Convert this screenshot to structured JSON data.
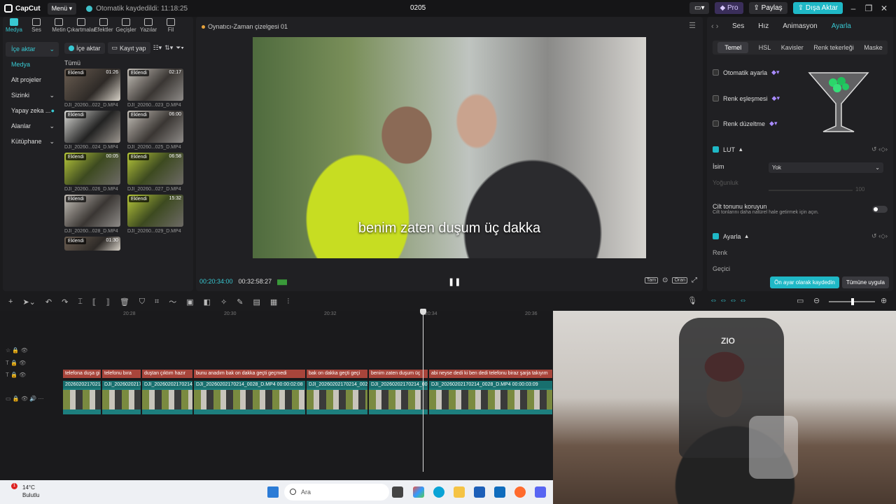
{
  "topbar": {
    "app_name": "CapCut",
    "menu_label": "Menü",
    "autosave_text": "Otomatik kaydedildi: 11:18:25",
    "project_title": "0205",
    "pro_label": "Pro",
    "share_label": "Paylaş",
    "export_label": "Dışa Aktar"
  },
  "tools": [
    "Medya",
    "Ses",
    "Metin",
    "Çıkartmalar",
    "Efektler",
    "Geçişler",
    "Yazılar",
    "Fil"
  ],
  "sidebar": {
    "items": [
      {
        "label": "İçe aktar"
      },
      {
        "label": "Medya"
      },
      {
        "label": "Alt projeler"
      },
      {
        "label": "Sizinki"
      },
      {
        "label": "Yapay zeka ..."
      },
      {
        "label": "Alanlar"
      },
      {
        "label": "Kütüphane"
      }
    ]
  },
  "media": {
    "import_label": "İçe aktar",
    "record_label": "Kayıt yap",
    "all_label": "Tümü",
    "clips": [
      {
        "tag": "Eklendi",
        "dur": "01:26",
        "name": "DJI_20260...022_D.MP4"
      },
      {
        "tag": "Eklendi",
        "dur": "02:17",
        "name": "DJI_20260...023_D.MP4"
      },
      {
        "tag": "Eklendi",
        "dur": "",
        "name": "DJI_20260...024_D.MP4"
      },
      {
        "tag": "Eklendi",
        "dur": "06:00",
        "name": "DJI_20260...025_D.MP4"
      },
      {
        "tag": "Eklendi",
        "dur": "00:05",
        "name": "DJI_20260...026_D.MP4"
      },
      {
        "tag": "Eklendi",
        "dur": "06:58",
        "name": "DJI_20260...027_D.MP4"
      },
      {
        "tag": "Eklendi",
        "dur": "",
        "name": "DJI_20260...028_D.MP4"
      },
      {
        "tag": "Eklendi",
        "dur": "15:32",
        "name": "DJI_20260...029_D.MP4"
      },
      {
        "tag": "Eklendi",
        "dur": "01:30",
        "name": ""
      }
    ]
  },
  "player": {
    "title": "Oynatıcı-Zaman çizelgesi 01",
    "subtitle": "benim zaten duşum üç dakka",
    "current_time": "00:20:34:00",
    "total_time": "00:32:58:27",
    "full_label": "Tam",
    "ratio_label": "Oran"
  },
  "rpanel": {
    "tabs": [
      "Ses",
      "Hız",
      "Animasyon",
      "Ayarla"
    ],
    "subtabs": [
      "Temel",
      "HSL",
      "Kavisler",
      "Renk tekerleği",
      "Maske"
    ],
    "auto_adjust": "Otomatik ayarla",
    "color_match": "Renk eşleşmesi",
    "color_correct": "Renk düzeltme",
    "lut": "LUT",
    "name_label": "İsim",
    "name_value": "Yok",
    "intensity_label": "Yoğunluk",
    "intensity_value": "100",
    "skin_title": "Cilt tonunu koruyun",
    "skin_desc": "Cilt tonlarını daha natürel hale getirmek için açın.",
    "adjust": "Ayarla",
    "color_label": "Renk",
    "temp_label": "Geçici",
    "save_preset": "Ön ayar olarak kaydedin",
    "apply_all": "Tümüne uygula"
  },
  "timeline": {
    "ruler": [
      "20:28",
      "20:30",
      "20:32",
      "20:34",
      "20:36"
    ],
    "text_clips": [
      "telefona duşa gi",
      "telefonu bıra",
      "duştan çıktım hazır",
      "bunu anadım bak on dakka geçti geçmedi",
      "bak on dakka geçti geçi",
      "benim zaten duşum üç",
      "abi neyse dedi ki ben dedi telefonu biraz şarja takıyım"
    ],
    "video_clips": [
      {
        "name": "20260202170214_00",
        "dur": ""
      },
      {
        "name": "DJI_2026020217(",
        "dur": ""
      },
      {
        "name": "DJI_20260202170214_00",
        "dur": ""
      },
      {
        "name": "DJI_20260202170214_0028_D.MP4",
        "dur": "00:00:02:08"
      },
      {
        "name": "DJI_20260202170214_0028",
        "dur": ""
      },
      {
        "name": "DJI_20260202170214_0028",
        "dur": ""
      },
      {
        "name": "DJI_20260202170214_0028_D.MP4",
        "dur": "00:00:03:09"
      }
    ]
  },
  "webcam": {
    "logo": "ZIO"
  },
  "taskbar": {
    "temp": "14°C",
    "weather": "Bulutlu",
    "badge": "1",
    "search": "Ara"
  },
  "colors": {
    "accent": "#1fb8c6",
    "text_clip": "#a8453b",
    "video_clip": "#1d7f7e"
  }
}
